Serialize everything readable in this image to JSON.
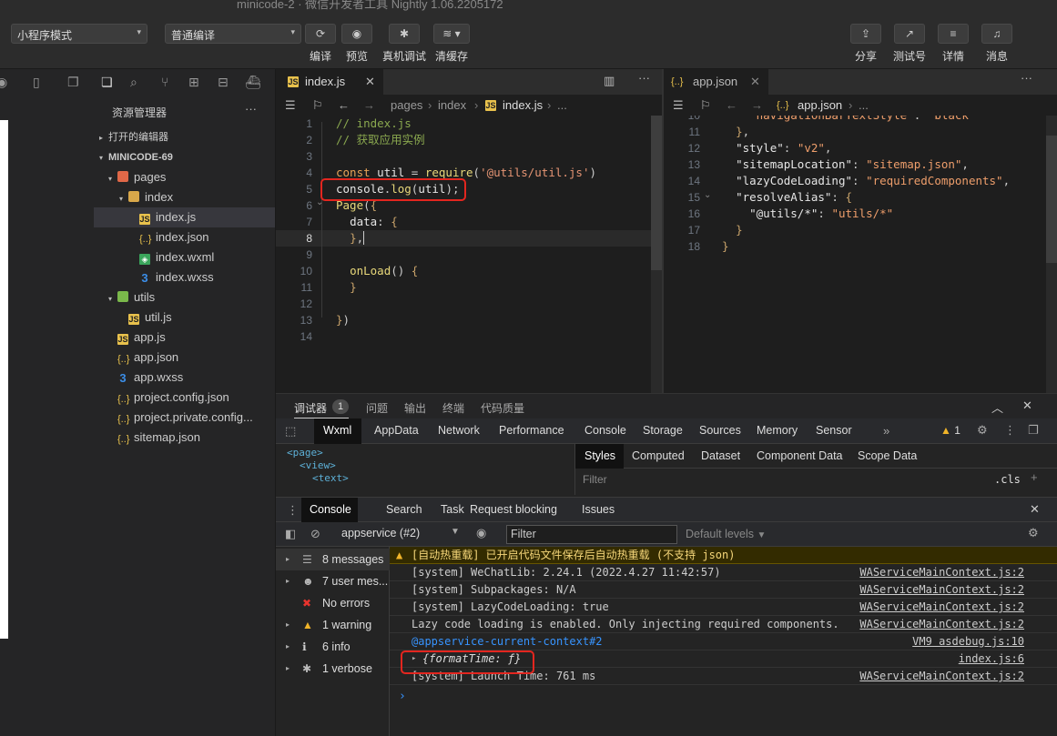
{
  "window": {
    "title": "minicode-2 · 微信开发者工具 Nightly 1.06.2205172"
  },
  "toolbar": {
    "mode_select": "小程序模式",
    "compile_select": "普通编译",
    "buttons": [
      {
        "label": "编译",
        "icon": "refresh-icon"
      },
      {
        "label": "预览",
        "icon": "eye-icon"
      },
      {
        "label": "真机调试",
        "icon": "bug-icon"
      },
      {
        "label": "清缓存",
        "icon": "layers-icon"
      }
    ],
    "right_buttons": [
      {
        "label": "分享",
        "icon": "share-icon"
      },
      {
        "label": "测试号",
        "icon": "external-link-icon"
      },
      {
        "label": "详情",
        "icon": "menu-icon"
      },
      {
        "label": "消息",
        "icon": "bell-icon"
      }
    ]
  },
  "explorer": {
    "title": "资源管理器",
    "open_editors": "打开的编辑器",
    "project": "MINICODE-69",
    "tree": [
      {
        "label": "pages",
        "type": "folder-pages",
        "depth": 1,
        "arrow": "▾"
      },
      {
        "label": "index",
        "type": "folder",
        "depth": 2,
        "arrow": "▾"
      },
      {
        "label": "index.js",
        "type": "js",
        "depth": 3,
        "selected": true
      },
      {
        "label": "index.json",
        "type": "json",
        "depth": 3
      },
      {
        "label": "index.wxml",
        "type": "wxml",
        "depth": 3
      },
      {
        "label": "index.wxss",
        "type": "wxss",
        "depth": 3
      },
      {
        "label": "utils",
        "type": "folder-green",
        "depth": 1,
        "arrow": "▾"
      },
      {
        "label": "util.js",
        "type": "js",
        "depth": 2
      },
      {
        "label": "app.js",
        "type": "js",
        "depth": 1
      },
      {
        "label": "app.json",
        "type": "json",
        "depth": 1
      },
      {
        "label": "app.wxss",
        "type": "wxss",
        "depth": 1
      },
      {
        "label": "project.config.json",
        "type": "json",
        "depth": 1
      },
      {
        "label": "project.private.config...",
        "type": "json",
        "depth": 1
      },
      {
        "label": "sitemap.json",
        "type": "json",
        "depth": 1
      }
    ]
  },
  "editor_left": {
    "tab": "index.js",
    "breadcrumb": [
      "pages",
      "index",
      "index.js",
      "..."
    ],
    "line_numbers": [
      "1",
      "2",
      "3",
      "4",
      "5",
      "6",
      "7",
      "8",
      "9",
      "10",
      "11",
      "12",
      "13",
      "14"
    ]
  },
  "editor_right": {
    "tab": "app.json",
    "breadcrumb": [
      "app.json",
      "..."
    ],
    "line_numbers": [
      "10",
      "11",
      "12",
      "13",
      "14",
      "15",
      "16",
      "17",
      "18"
    ]
  },
  "devtools": {
    "tabs": [
      {
        "label": "调试器"
      },
      {
        "label": "问题"
      },
      {
        "label": "输出"
      },
      {
        "label": "终端"
      },
      {
        "label": "代码质量"
      }
    ],
    "debugger_badge": "1",
    "panels": [
      "Wxml",
      "AppData",
      "Network",
      "Performance",
      "Console",
      "Storage",
      "Sources",
      "Memory",
      "Sensor"
    ],
    "more": "»",
    "warning_count": "1",
    "wxml_lines": [
      "<page>",
      "<view>",
      "<text>"
    ],
    "styles_tabs": [
      "Styles",
      "Computed",
      "Dataset",
      "Component Data",
      "Scope Data"
    ],
    "styles_filter": "Filter",
    "cls": ".cls",
    "drawer_tabs": [
      "Console",
      "Search",
      "Task",
      "Request blocking",
      "Issues"
    ],
    "context": "appservice (#2)",
    "filter_placeholder": "Filter",
    "levels": "Default levels",
    "sidebar": [
      {
        "label": "8 messages",
        "icon": "list-icon"
      },
      {
        "label": "7 user mes...",
        "icon": "user-icon"
      },
      {
        "label": "No errors",
        "icon": "error-icon"
      },
      {
        "label": "1 warning",
        "icon": "warning-icon"
      },
      {
        "label": "6 info",
        "icon": "info-icon"
      },
      {
        "label": "1 verbose",
        "icon": "bug-icon"
      }
    ],
    "logs": [
      {
        "text": "[自动热重载] 已开启代码文件保存后自动热重载 (不支持 json)",
        "link": "",
        "kind": "warn"
      },
      {
        "text": "[system] WeChatLib: 2.24.1 (2022.4.27 11:42:57)",
        "link": "WAServiceMainContext.js:2",
        "kind": "log"
      },
      {
        "text": "[system] Subpackages: N/A",
        "link": "WAServiceMainContext.js:2",
        "kind": "log"
      },
      {
        "text": "[system] LazyCodeLoading: true",
        "link": "WAServiceMainContext.js:2",
        "kind": "log"
      },
      {
        "text": "Lazy code loading is enabled. Only injecting required components.",
        "link": "WAServiceMainContext.js:2",
        "kind": "log"
      },
      {
        "text": "@appservice-current-context#2",
        "link": "VM9 asdebug.js:10",
        "kind": "context"
      },
      {
        "text": "{formatTime: ƒ}",
        "link": "index.js:6",
        "kind": "object"
      },
      {
        "text": "[system] Launch Time: 761 ms",
        "link": "WAServiceMainContext.js:2",
        "kind": "log"
      }
    ],
    "prompt": "›"
  },
  "colors": {
    "accent": "#3794ff",
    "highlight_box": "#e3261f",
    "warn_bg": "#332b00"
  }
}
